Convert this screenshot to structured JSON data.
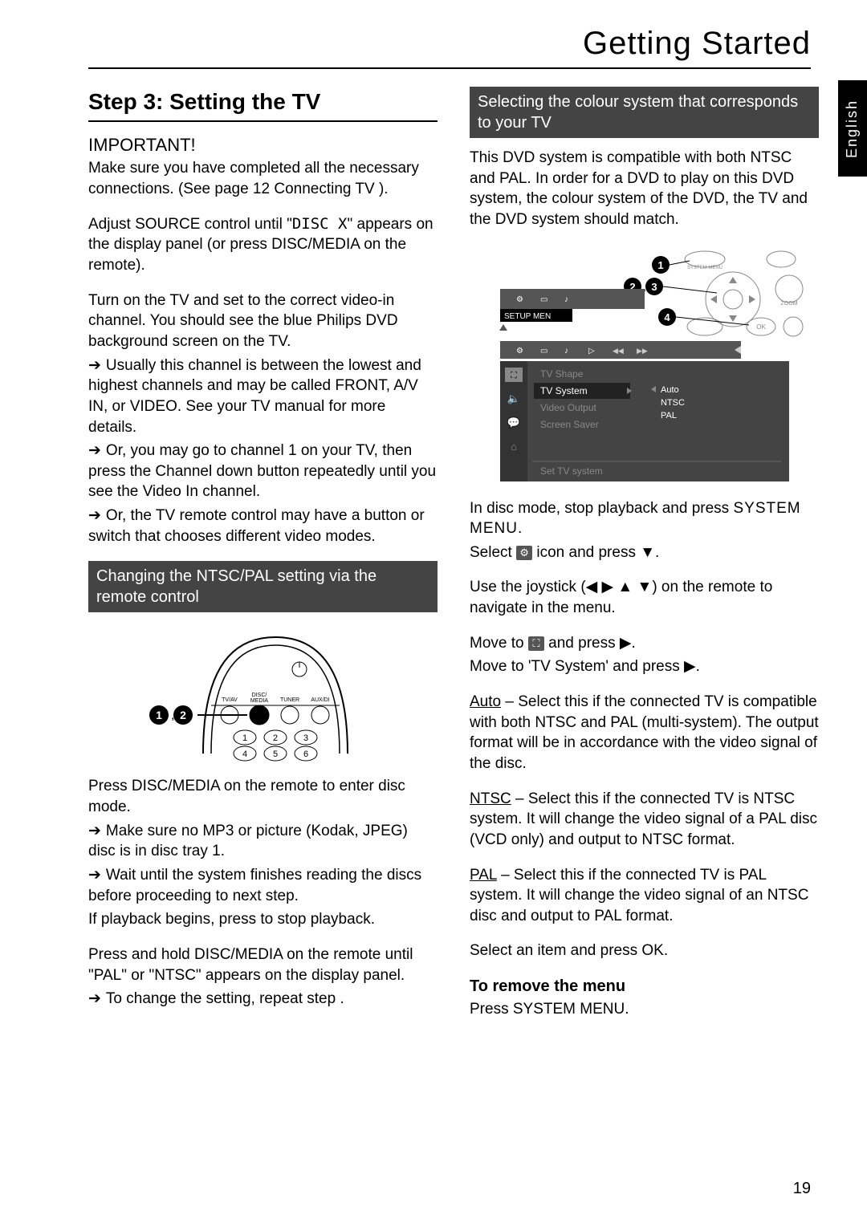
{
  "header": {
    "title": "Getting Started",
    "language_tab": "English"
  },
  "left": {
    "step_heading": "Step 3:  Setting the TV",
    "important": "IMPORTANT!",
    "important_body_a": "Make sure you have completed all the necessary connections. (See page 12 ",
    "important_body_b": "Connecting TV",
    "important_body_c": ").",
    "p1a": "Adjust SOURCE control until \"",
    "p1b": "DISC X",
    "p1c": "\" appears on the display panel (or press DISC/MEDIA on the remote).",
    "p2": "Turn on the TV and set to the correct video-in channel. You should see the blue Philips DVD background screen on the TV.",
    "p2_arrow1": "Usually this channel is between the lowest and highest channels and may be called FRONT, A/V IN, or VIDEO. See your TV manual for more details.",
    "p2_arrow2": "Or, you may go to channel 1 on your TV, then press the Channel down button repeatedly until you see the Video In channel.",
    "p2_arrow3": "Or, the TV remote control may have a button or switch that chooses different video modes.",
    "sub_heading_1": "Changing the NTSC/PAL setting via the remote control",
    "remote": {
      "callout": "1,2",
      "labels": {
        "tvav": "TV/AV",
        "disc": "DISC/\nMEDIA",
        "tuner": "TUNER",
        "auxdi": "AUX/DI"
      }
    },
    "p3": "Press DISC/MEDIA on the remote to enter disc mode.",
    "p3_arrow1": "Make sure no MP3 or picture (Kodak, JPEG) disc is in disc tray 1.",
    "p3_arrow2": "Wait until the system finishes reading the discs before proceeding to next step.",
    "p3_c": "If playback begins, press      to stop playback.",
    "p4": "Press and hold DISC/MEDIA on the remote until \"PAL\" or \"NTSC\" appears on the display panel.",
    "p4_arrow1": "To change the setting, repeat step     ."
  },
  "right": {
    "sub_heading_1": "Selecting the colour system that corresponds to your TV",
    "p1": "This DVD system is compatible with both NTSC and PAL. In order for a DVD to play on this DVD system, the colour system of the DVD, the TV and the DVD system should match.",
    "osd": {
      "setup_menu": "SETUP MEN",
      "menu_items": [
        "TV Shape",
        "TV System",
        "Video Output",
        "Screen Saver"
      ],
      "help_bar": "Set TV system",
      "options": [
        "Auto",
        "NTSC",
        "PAL"
      ],
      "callouts": [
        "1",
        "2",
        "3",
        "4"
      ],
      "btn_labels": [
        "SYSTEM MENU",
        "ZOOM",
        "OK"
      ]
    },
    "p2a": "In disc mode, stop playback and press ",
    "p2b": "SYSTEM MENU.",
    "p3a": "Select ",
    "p3b": " icon and press ▼.",
    "p4": "Use the joystick (◀ ▶ ▲ ▼) on the remote to navigate in the menu.",
    "p5a": "Move to ",
    "p5b": " and press ▶.",
    "p5c": "Move to 'TV System' and press ▶.",
    "auto_label": "Auto",
    "auto_txt": " – Select this if the connected TV is compatible with both NTSC and PAL (multi-system). The output format will be in accordance with the video signal of the disc.",
    "ntsc_label": "NTSC",
    "ntsc_txt": " – Select this if the connected TV is NTSC system. It will change the video signal of a PAL disc (VCD only) and output to NTSC format.",
    "pal_label": "PAL",
    "pal_txt": " – Select this if the connected TV is PAL system. It will change the video signal of an NTSC disc and output to PAL format.",
    "p6": "Select an item and press OK.",
    "remove_h": "To remove the menu",
    "remove_b": "Press SYSTEM MENU."
  },
  "page_number": "19"
}
